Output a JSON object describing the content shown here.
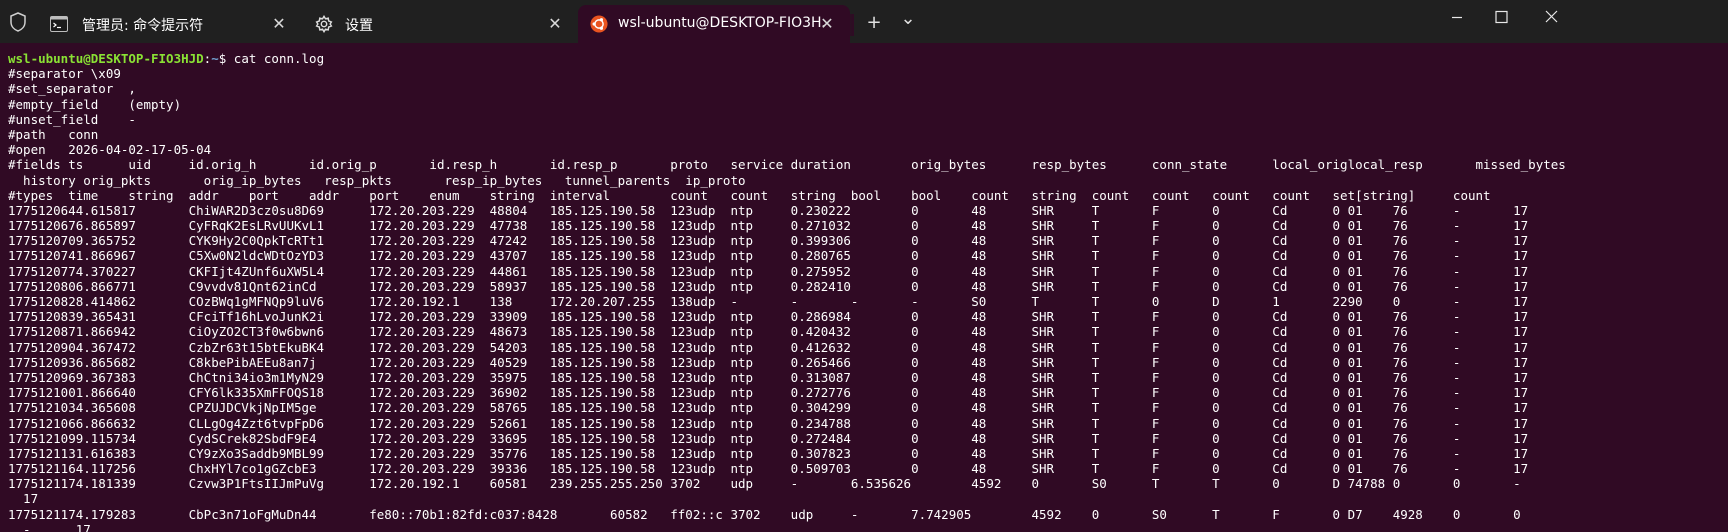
{
  "window": {
    "tabs": [
      {
        "title": "管理员: 命令提示符",
        "icon": "cmd-icon"
      },
      {
        "title": "设置",
        "icon": "gear-icon"
      },
      {
        "title": "wsl-ubuntu@DESKTOP-FIO3H.",
        "icon": "ubuntu-icon"
      }
    ],
    "close_glyph": "✕",
    "new_tab_glyph": "+",
    "dropdown_glyph": "⌄"
  },
  "terminal": {
    "prompt": {
      "user_host": "wsl-ubuntu@DESKTOP-FIO3HJD",
      "colon": ":",
      "path": "~",
      "dollar": "$ ",
      "command": "cat conn.log"
    },
    "lines": [
      "#separator \\x09",
      "#set_separator  ,",
      "#empty_field    (empty)",
      "#unset_field    -",
      "#path   conn",
      "#open   2026-04-02-17-05-04",
      "#fields ts      uid     id.orig_h       id.orig_p       id.resp_h       id.resp_p       proto   service duration        orig_bytes      resp_bytes      conn_state      local_origlocal_resp       missed_bytes",
      "  history orig_pkts       orig_ip_bytes   resp_pkts       resp_ip_bytes   tunnel_parents  ip_proto",
      "#types  time    string  addr    port    addr    port    enum    string  interval        count   count   string  bool    bool    count   string  count   count   count   count   set[string]     count",
      "1775120644.615817       ChiWAR2D3cz0su8D69      172.20.203.229  48804   185.125.190.58  123udp  ntp     0.230222        0       48      SHR     T       F       0       Cd      0 01    76      -       17",
      "1775120676.865897       CyFRqK2EsLRvUUKvL1      172.20.203.229  47738   185.125.190.58  123udp  ntp     0.271032        0       48      SHR     T       F       0       Cd      0 01    76      -       17",
      "1775120709.365752       CYK9Hy2C0QpkTcRTt1      172.20.203.229  47242   185.125.190.58  123udp  ntp     0.399306        0       48      SHR     T       F       0       Cd      0 01    76      -       17",
      "1775120741.866967       C5Xw0N2ldcWDtOzYD3      172.20.203.229  43707   185.125.190.58  123udp  ntp     0.280765        0       48      SHR     T       F       0       Cd      0 01    76      -       17",
      "1775120774.370227       CKFIjt4ZUnf6uXW5L4      172.20.203.229  44861   185.125.190.58  123udp  ntp     0.275952        0       48      SHR     T       F       0       Cd      0 01    76      -       17",
      "1775120806.866771       C9vvdv81Qnt62inCd       172.20.203.229  58937   185.125.190.58  123udp  ntp     0.282410        0       48      SHR     T       F       0       Cd      0 01    76      -       17",
      "1775120828.414862       COzBWq1gMFNQp9luV6      172.20.192.1    138     172.20.207.255  138udp  -       -       -       -       S0      T       T       0       D       1       2290    0       -       17",
      "1775120839.365431       CFciTf16hLvoJunK2i      172.20.203.229  33909   185.125.190.58  123udp  ntp     0.286984        0       48      SHR     T       F       0       Cd      0 01    76      -       17",
      "1775120871.866942       CiOyZO2CT3f0w6bwn6      172.20.203.229  48673   185.125.190.58  123udp  ntp     0.420432        0       48      SHR     T       F       0       Cd      0 01    76      -       17",
      "1775120904.367472       CzbZr63t15btEkuBK4      172.20.203.229  54203   185.125.190.58  123udp  ntp     0.412632        0       48      SHR     T       F       0       Cd      0 01    76      -       17",
      "1775120936.865682       C8kbePibAEEu8an7j       172.20.203.229  40529   185.125.190.58  123udp  ntp     0.265466        0       48      SHR     T       F       0       Cd      0 01    76      -       17",
      "1775120969.367383       ChCtni34io3m1MyN29      172.20.203.229  35975   185.125.190.58  123udp  ntp     0.313087        0       48      SHR     T       F       0       Cd      0 01    76      -       17",
      "1775121001.866640       CFY6lk335XmFFOQS18      172.20.203.229  36902   185.125.190.58  123udp  ntp     0.272776        0       48      SHR     T       F       0       Cd      0 01    76      -       17",
      "1775121034.365608       CPZUJDCVkjNpIM5ge       172.20.203.229  58765   185.125.190.58  123udp  ntp     0.304299        0       48      SHR     T       F       0       Cd      0 01    76      -       17",
      "1775121066.866632       CLLgOg4Zzt6tvpFpD6      172.20.203.229  52661   185.125.190.58  123udp  ntp     0.234788        0       48      SHR     T       F       0       Cd      0 01    76      -       17",
      "1775121099.115734       CydSCrek82SbdF9E4       172.20.203.229  33695   185.125.190.58  123udp  ntp     0.272484        0       48      SHR     T       F       0       Cd      0 01    76      -       17",
      "1775121131.616383       CY9zXo3Saddb9MBL99      172.20.203.229  35776   185.125.190.58  123udp  ntp     0.307823        0       48      SHR     T       F       0       Cd      0 01    76      -       17",
      "1775121164.117256       ChxHYl7co1gGZcbE3       172.20.203.229  39336   185.125.190.58  123udp  ntp     0.509703        0       48      SHR     T       F       0       Cd      0 01    76      -       17",
      "1775121174.181339       Czvw3P1FtsIIJmPuVg      172.20.192.1    60581   239.255.255.250 3702    udp     -       6.535626        4592    0       S0      T       T       0       D 74788 0       0       -",
      "  17",
      "1775121174.179283       CbPc3n71oFgMuDn44       fe80::70b1:82fd:c037:8428       60582   ff02::c 3702    udp     -       7.742905        4592    0       S0      T       F       0 D7    4928    0       0",
      "  -      17"
    ]
  },
  "colors": {
    "terminal_bg": "#300a24",
    "titlebar_bg": "#202020",
    "prompt_user": "#8ae234",
    "prompt_path": "#729fcf",
    "ubuntu_orange": "#e95420"
  }
}
